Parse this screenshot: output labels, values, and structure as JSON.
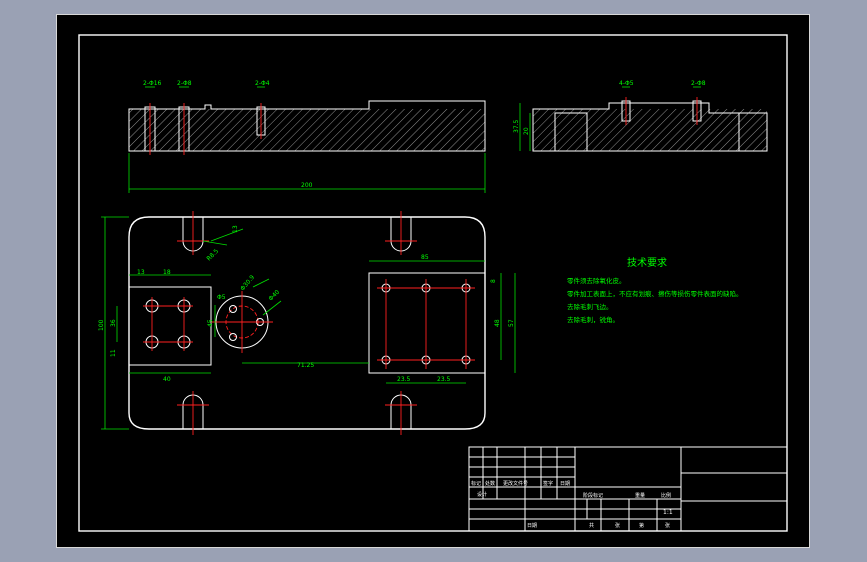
{
  "drawing": {
    "dims": {
      "top_view_hole1": "2-Φ16",
      "top_view_hole2": "2-Φ8",
      "top_view_hole3": "2-Φ4",
      "side_view_hole1": "4-Φ5",
      "side_view_hole2": "2-Φ8",
      "side_height_outer": "37.5",
      "side_height_inner": "20",
      "overall_length": "200",
      "slot_width": "13",
      "slot_radius": "R8.5",
      "block_w1": "13",
      "block_w2": "18",
      "block_h1": "36",
      "block_h2": "11",
      "block_total_h": "100",
      "block_width": "40",
      "circle_dia": "Φ40",
      "circle_pcd": "Φ30.9",
      "circle_hole": "Φ5",
      "circle_height": "45",
      "center_offset": "71.25",
      "right_width": "85",
      "right_top": "8",
      "right_h1": "48",
      "right_h2": "57",
      "right_pitch1": "23.5",
      "right_pitch2": "23.5"
    },
    "tech": {
      "title": "技术要求",
      "line1": "零件须去除氧化皮。",
      "line2": "零件加工表面上，不应有划痕、擦伤等损伤零件表面的缺陷。",
      "line3": "去除毛刺飞边。",
      "line4": "去除毛刺，锐角。"
    },
    "title_block": {
      "mark": "标记",
      "count": "处数",
      "change_doc": "更改文件号",
      "sign": "签字",
      "date": "日期",
      "design": "设计",
      "stage_mark": "阶段标记",
      "weight": "重量",
      "scale": "比例",
      "scale_value": "1:1",
      "approve": "日期",
      "sheet_total": "共",
      "sheet_num": "张",
      "sheet_of": "第",
      "sheet_of2": "张"
    }
  }
}
